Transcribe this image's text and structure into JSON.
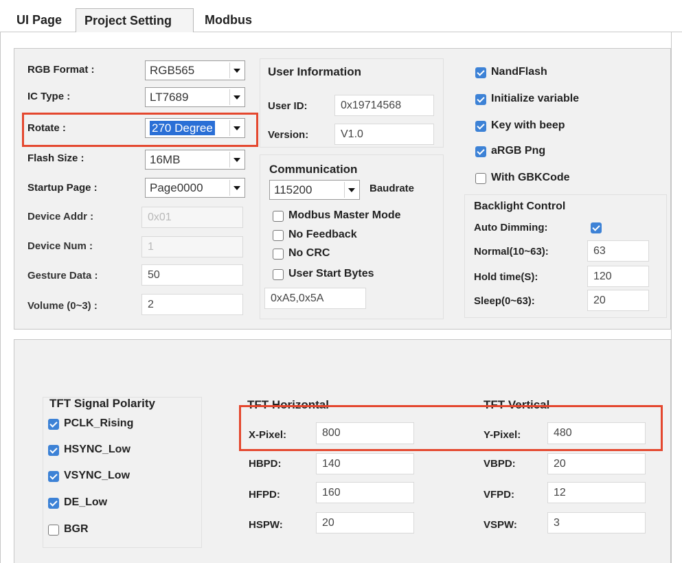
{
  "tabs": [
    {
      "label": "UI Page",
      "active": false
    },
    {
      "label": "Project Setting",
      "active": true
    },
    {
      "label": "Modbus",
      "active": false
    }
  ],
  "project": {
    "rgb_format": {
      "label": "RGB Format :",
      "value": "RGB565"
    },
    "ic_type": {
      "label": "IC Type :",
      "value": "LT7689"
    },
    "rotate": {
      "label": "Rotate :",
      "value": "270 Degree"
    },
    "flash_size": {
      "label": "Flash Size :",
      "value": "16MB"
    },
    "startup_page": {
      "label": "Startup Page :",
      "value": "Page0000"
    },
    "device_addr": {
      "label": "Device Addr :",
      "value": "0x01"
    },
    "device_num": {
      "label": "Device Num :",
      "value": "1"
    },
    "gesture_data": {
      "label": "Gesture Data :",
      "value": "50"
    },
    "volume": {
      "label": "Volume (0~3) :",
      "value": "2"
    }
  },
  "user_info": {
    "title": "User Information",
    "user_id": {
      "label": "User ID:",
      "value": "0x19714568"
    },
    "version": {
      "label": "Version:",
      "value": "V1.0"
    }
  },
  "communication": {
    "title": "Communication",
    "baudrate_value": "115200",
    "baudrate_label": "Baudrate",
    "modbus_master": {
      "label": "Modbus Master Mode",
      "checked": false
    },
    "no_feedback": {
      "label": "No Feedback",
      "checked": false
    },
    "no_crc": {
      "label": "No CRC",
      "checked": false
    },
    "user_start_bytes": {
      "label": "User Start Bytes",
      "checked": false
    },
    "start_bytes_value": "0xA5,0x5A"
  },
  "options": [
    {
      "label": "NandFlash",
      "checked": true
    },
    {
      "label": "Initialize variable",
      "checked": true
    },
    {
      "label": "Key with beep",
      "checked": true
    },
    {
      "label": "aRGB Png",
      "checked": true
    },
    {
      "label": "With GBKCode",
      "checked": false
    }
  ],
  "backlight": {
    "title": "Backlight Control",
    "auto_dimming": {
      "label": "Auto Dimming:",
      "checked": true
    },
    "normal": {
      "label": "Normal(10~63):",
      "value": "63"
    },
    "hold_time": {
      "label": "Hold time(S):",
      "value": "120"
    },
    "sleep": {
      "label": "Sleep(0~63):",
      "value": "20"
    }
  },
  "tft_polarity": {
    "title": "TFT Signal Polarity",
    "items": [
      {
        "label": "PCLK_Rising",
        "checked": true
      },
      {
        "label": "HSYNC_Low",
        "checked": true
      },
      {
        "label": "VSYNC_Low",
        "checked": true
      },
      {
        "label": "DE_Low",
        "checked": true
      },
      {
        "label": "BGR",
        "checked": false
      }
    ]
  },
  "tft_horizontal": {
    "title": "TFT Horizontal",
    "x_pixel": {
      "label": "X-Pixel:",
      "value": "800"
    },
    "hbpd": {
      "label": "HBPD:",
      "value": "140"
    },
    "hfpd": {
      "label": "HFPD:",
      "value": "160"
    },
    "hspw": {
      "label": "HSPW:",
      "value": "20"
    }
  },
  "tft_vertical": {
    "title": "TFT Vertical",
    "y_pixel": {
      "label": "Y-Pixel:",
      "value": "480"
    },
    "vbpd": {
      "label": "VBPD:",
      "value": "20"
    },
    "vfpd": {
      "label": "VFPD:",
      "value": "12"
    },
    "vspw": {
      "label": "VSPW:",
      "value": "3"
    }
  },
  "colors": {
    "accent": "#3d82d6",
    "highlight_box": "#e4472e",
    "selection": "#2a6fd6"
  }
}
